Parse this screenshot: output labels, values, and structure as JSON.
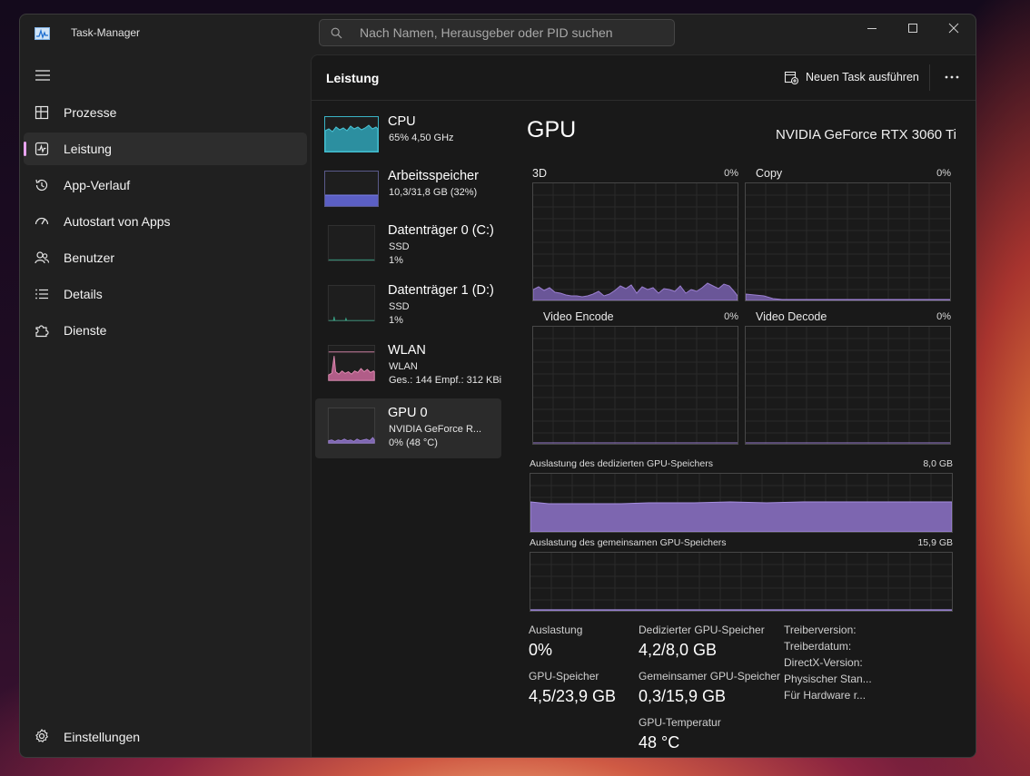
{
  "window": {
    "title": "Task-Manager"
  },
  "search": {
    "placeholder": "Nach Namen, Herausgeber oder PID suchen"
  },
  "nav": {
    "items": [
      {
        "label": "Prozesse",
        "icon": "processes-icon"
      },
      {
        "label": "Leistung",
        "icon": "performance-icon"
      },
      {
        "label": "App-Verlauf",
        "icon": "history-icon"
      },
      {
        "label": "Autostart von Apps",
        "icon": "speedometer-icon"
      },
      {
        "label": "Benutzer",
        "icon": "users-icon"
      },
      {
        "label": "Details",
        "icon": "list-icon"
      },
      {
        "label": "Dienste",
        "icon": "puzzle-icon"
      }
    ],
    "active": "Leistung",
    "settings_label": "Einstellungen"
  },
  "header": {
    "title": "Leistung",
    "run_task_label": "Neuen Task ausführen"
  },
  "resources": [
    {
      "name": "CPU",
      "sub1": "65% 4,50 GHz",
      "sub2": "",
      "color": "#3ab3c6"
    },
    {
      "name": "Arbeitsspeicher",
      "sub1": "10,3/31,8 GB (32%)",
      "sub2": "",
      "color": "#6b6fd8"
    },
    {
      "name": "Datenträger 0 (C:)",
      "sub1": "SSD",
      "sub2": "1%",
      "color": "#3aa88a"
    },
    {
      "name": "Datenträger 1 (D:)",
      "sub1": "SSD",
      "sub2": "1%",
      "color": "#3aa88a"
    },
    {
      "name": "WLAN",
      "sub1": "WLAN",
      "sub2": "Ges.: 144 Empf.: 312 KBi",
      "color": "#e58fb6"
    },
    {
      "name": "GPU 0",
      "sub1": "NVIDIA GeForce R...",
      "sub2": "0% (48 °C)",
      "color": "#9b7fd0"
    }
  ],
  "gpu": {
    "title": "GPU",
    "model": "NVIDIA GeForce RTX 3060 Ti",
    "color": "#9b7fd0",
    "engines": [
      {
        "name": "3D",
        "percent": "0%"
      },
      {
        "name": "Copy",
        "percent": "0%"
      },
      {
        "name": "Video Encode",
        "percent": "0%"
      },
      {
        "name": "Video Decode",
        "percent": "0%"
      }
    ],
    "dedicated_label": "Auslastung des dedizierten GPU-Speichers",
    "dedicated_max": "8,0 GB",
    "dedicated_fraction": 0.52,
    "shared_label": "Auslastung des gemeinsamen GPU-Speichers",
    "shared_max": "15,9 GB",
    "shared_fraction": 0.02
  },
  "stats": {
    "utilization_label": "Auslastung",
    "utilization_value": "0%",
    "gpu_memory_label": "GPU-Speicher",
    "gpu_memory_value": "4,5/23,9 GB",
    "dedicated_label": "Dedizierter GPU-Speicher",
    "dedicated_value": "4,2/8,0 GB",
    "shared_label": "Gemeinsamer GPU-Speicher",
    "shared_value": "0,3/15,9 GB",
    "temp_label": "GPU-Temperatur",
    "temp_value": "48 °C",
    "details": [
      "Treiberversion:",
      "Treiberdatum:",
      "DirectX-Version:",
      "Physischer Stan...",
      "Für Hardware r..."
    ]
  }
}
